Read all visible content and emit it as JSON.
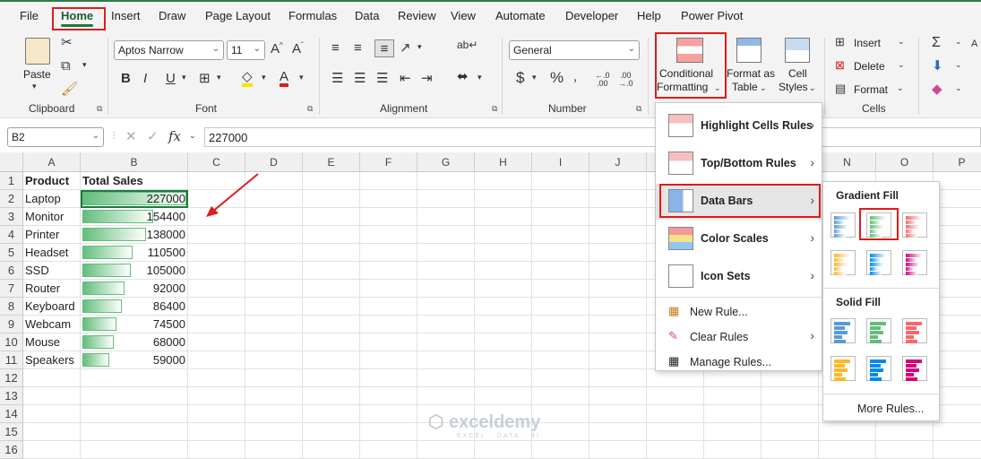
{
  "tabs": [
    "File",
    "Home",
    "Insert",
    "Draw",
    "Page Layout",
    "Formulas",
    "Data",
    "Review",
    "View",
    "Automate",
    "Developer",
    "Help",
    "Power Pivot"
  ],
  "clipboard": {
    "paste": "Paste",
    "group": "Clipboard"
  },
  "font": {
    "name": "Aptos Narrow",
    "size": "11",
    "group": "Font",
    "bold": "B",
    "italic": "I",
    "underline": "U"
  },
  "alignment": {
    "group": "Alignment"
  },
  "number": {
    "format": "General",
    "group": "Number",
    "currency": "$",
    "percent": "%"
  },
  "styles": {
    "cf_line1": "Conditional",
    "cf_line2": "Formatting",
    "fat_line1": "Format as",
    "fat_line2": "Table",
    "cs_line1": "Cell",
    "cs_line2": "Styles"
  },
  "cells": {
    "insert": "Insert",
    "delete": "Delete",
    "format": "Format",
    "group": "Cells"
  },
  "formula_bar": {
    "name_box": "B2",
    "fx": "fx",
    "value": "227000"
  },
  "columns": [
    "A",
    "B",
    "C",
    "D",
    "E",
    "F",
    "G",
    "H",
    "I",
    "J",
    "K",
    "L",
    "M",
    "N",
    "O",
    "P"
  ],
  "rows": [
    "1",
    "2",
    "3",
    "4",
    "5",
    "6",
    "7",
    "8",
    "9",
    "10",
    "11",
    "12",
    "13",
    "14",
    "15",
    "16"
  ],
  "headers": {
    "product": "Product",
    "sales": "Total Sales"
  },
  "data": [
    {
      "product": "Laptop",
      "sales": 227000,
      "label": "227000"
    },
    {
      "product": "Monitor",
      "sales": 154400,
      "label": "154400"
    },
    {
      "product": "Printer",
      "sales": 138000,
      "label": "138000"
    },
    {
      "product": "Headset",
      "sales": 110500,
      "label": "110500"
    },
    {
      "product": "SSD",
      "sales": 105000,
      "label": "105000"
    },
    {
      "product": "Router",
      "sales": 92000,
      "label": "92000"
    },
    {
      "product": "Keyboard",
      "sales": 86400,
      "label": "86400"
    },
    {
      "product": "Webcam",
      "sales": 74500,
      "label": "74500"
    },
    {
      "product": "Mouse",
      "sales": 68000,
      "label": "68000"
    },
    {
      "product": "Speakers",
      "sales": 59000,
      "label": "59000"
    }
  ],
  "cf_menu": {
    "highlight": "Highlight Cells Rules",
    "topbottom": "Top/Bottom Rules",
    "databars": "Data Bars",
    "colorscales": "Color Scales",
    "iconsets": "Icon Sets",
    "newrule": "New Rule...",
    "clearrules": "Clear Rules",
    "managerules": "Manage Rules..."
  },
  "databars_menu": {
    "gradient": "Gradient Fill",
    "solid": "Solid Fill",
    "more": "More Rules..."
  },
  "colors": {
    "green_accent": "#1c7a3e",
    "bar_green": "#63be7b",
    "highlight_red": "#e01b1b"
  }
}
